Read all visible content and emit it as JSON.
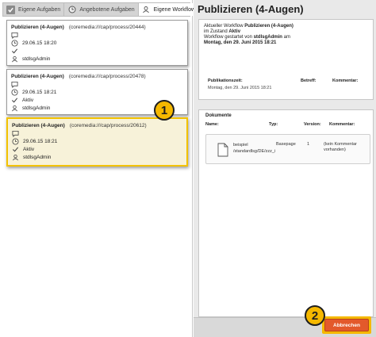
{
  "left": {
    "tabs": [
      {
        "label": "Eigene Aufgaben",
        "icon": "checkbox-icon"
      },
      {
        "label": "Angebotene Aufgaben",
        "icon": "clock-icon"
      },
      {
        "label": "Eigene Workflows",
        "icon": "user-icon"
      }
    ],
    "cards": [
      {
        "title": "Publizieren (4-Augen)",
        "path": "(coremedia:///cap/process/20444)",
        "date": "29.06.15 18:20",
        "status": "",
        "user": "stdlsgAdmin"
      },
      {
        "title": "Publizieren (4-Augen)",
        "path": "(coremedia:///cap/process/20478)",
        "date": "29.06.15 18:21",
        "status": "Aktiv",
        "user": "stdlsgAdmin"
      },
      {
        "title": "Publizieren (4-Augen)",
        "path": "(coremedia:///cap/process/20612)",
        "date": "29.06.15 18:21",
        "status": "Aktiv",
        "user": "stdlsgAdmin"
      }
    ],
    "badge": "1"
  },
  "right": {
    "title": "Publizieren (4-Augen)",
    "summary": {
      "line1_prefix": "Aktueller Workflow ",
      "line1_bold": "Publizieren (4-Augen)",
      "line2_prefix": "im Zustand ",
      "line2_bold": "Aktiv",
      "line3_prefix": "Workflow gestartet von ",
      "line3_bold": "stdlsgAdmin",
      "line3_suffix": " am",
      "line4_bold": "Montag, den 29. Juni 2015 18:21"
    },
    "publication": {
      "h_time": "Publikationszeit:",
      "h_subject": "Betreff:",
      "h_comment": "Kommentar:",
      "time_value": "Montag, den 29. Juni 2015 18:21"
    },
    "documents": {
      "title": "Dokumente",
      "h_name": "Name:",
      "h_type": "Typ:",
      "h_version": "Version:",
      "h_comment": "Kommentar:",
      "rows": [
        {
          "name_line1": "beispiel",
          "name_line2": "/standardlsg/DE/zzz_i",
          "type": "Basepage",
          "version": "1",
          "comment_line1": "(kein Kommentar",
          "comment_line2": "vorhanden)"
        }
      ]
    },
    "cancel_label": "Abbrechen",
    "badge": "2"
  },
  "colors": {
    "highlight": "#f5b800",
    "cancel": "#e3592b"
  }
}
